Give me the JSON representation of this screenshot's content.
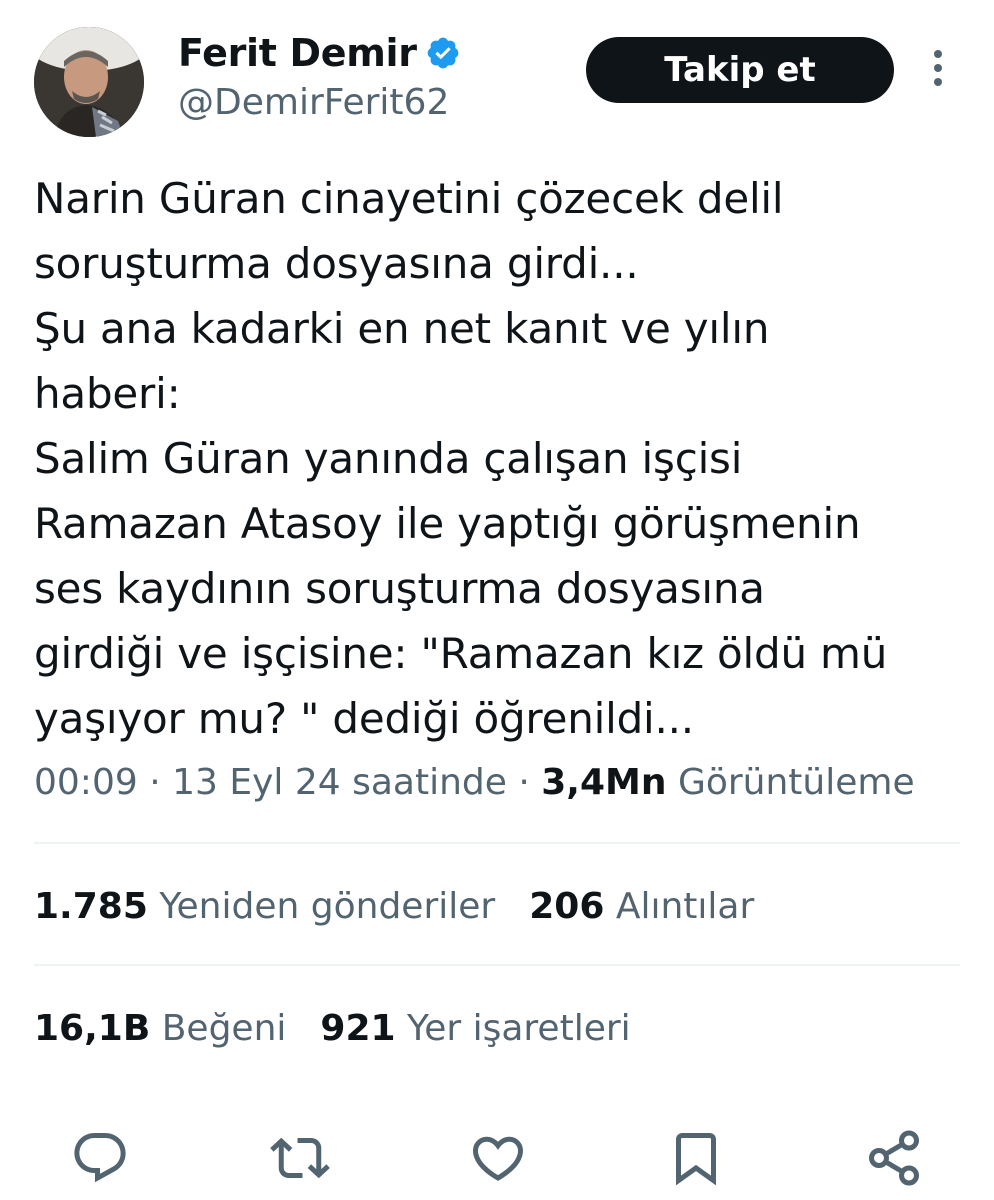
{
  "author": {
    "display_name": "Ferit Demir",
    "handle": "@DemirFerit62",
    "verified_icon": "verified-badge-icon",
    "verified_color": "#1d9bf0"
  },
  "follow_button": {
    "label": "Takip et"
  },
  "more_icon": "more-vertical-icon",
  "tweet": {
    "text": "Narin Güran cinayetini çözecek  delil\nsoruşturma dosyasına girdi...\nŞu ana kadarki en net kanıt ve yılın\nhaberi:\nSalim Güran yanında çalışan işçisi\nRamazan Atasoy ile yaptığı görüşmenin\nses kaydının soruşturma dosyasına\ngirdiği ve  işçisine: \"Ramazan kız öldü mü\nyaşıyor mu? \" dediği  öğrenildi..."
  },
  "meta": {
    "time": "00:09",
    "date": "13 Eyl 24 saatinde",
    "views_count": "3,4Mn",
    "views_label": "Görüntüleme"
  },
  "stats": {
    "reposts_count": "1.785",
    "reposts_label": "Yeniden gönderiler",
    "quotes_count": "206",
    "quotes_label": "Alıntılar",
    "likes_count": "16,1B",
    "likes_label": "Beğeni",
    "bookmarks_count": "921",
    "bookmarks_label": "Yer işaretleri"
  },
  "actions": [
    "reply-icon",
    "repost-icon",
    "like-icon",
    "bookmark-icon",
    "share-icon"
  ],
  "colors": {
    "text": "#0f1419",
    "secondary": "#536471",
    "button_bg": "#0f1419",
    "divider": "#eff3f4"
  }
}
